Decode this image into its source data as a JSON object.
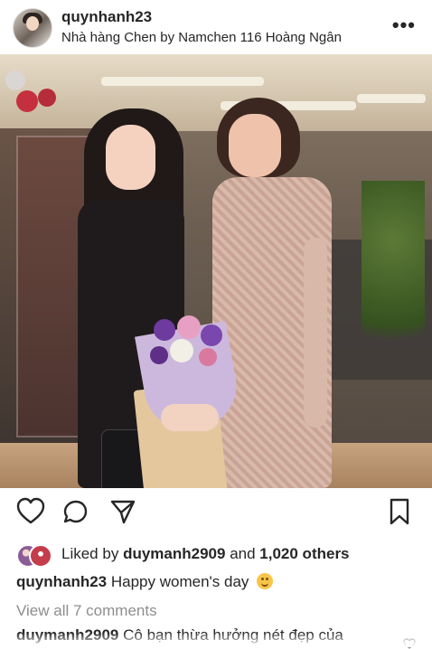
{
  "post": {
    "username": "quynhanh23",
    "location": "Nhà hàng Chen by Namchen 116 Hoàng Ngân",
    "more_icon": "more-options-icon",
    "actions": {
      "like_icon": "heart-icon",
      "comment_icon": "comment-icon",
      "share_icon": "share-icon",
      "save_icon": "bookmark-icon"
    },
    "likes": {
      "prefix": "Liked by",
      "user": "duymanh2909",
      "middle": "and",
      "others": "1,020 others"
    },
    "caption": {
      "username": "quynhanh23",
      "text": "Happy women's day",
      "emoji": "smiling-face-emoji"
    },
    "view_comments": "View all 7 comments",
    "comment": {
      "username": "duymanh2909",
      "text": "Cô bạn thừa hưởng nét đẹp của"
    }
  },
  "colors": {
    "text": "#262626",
    "muted": "#8e8e8e",
    "background": "#ffffff"
  }
}
